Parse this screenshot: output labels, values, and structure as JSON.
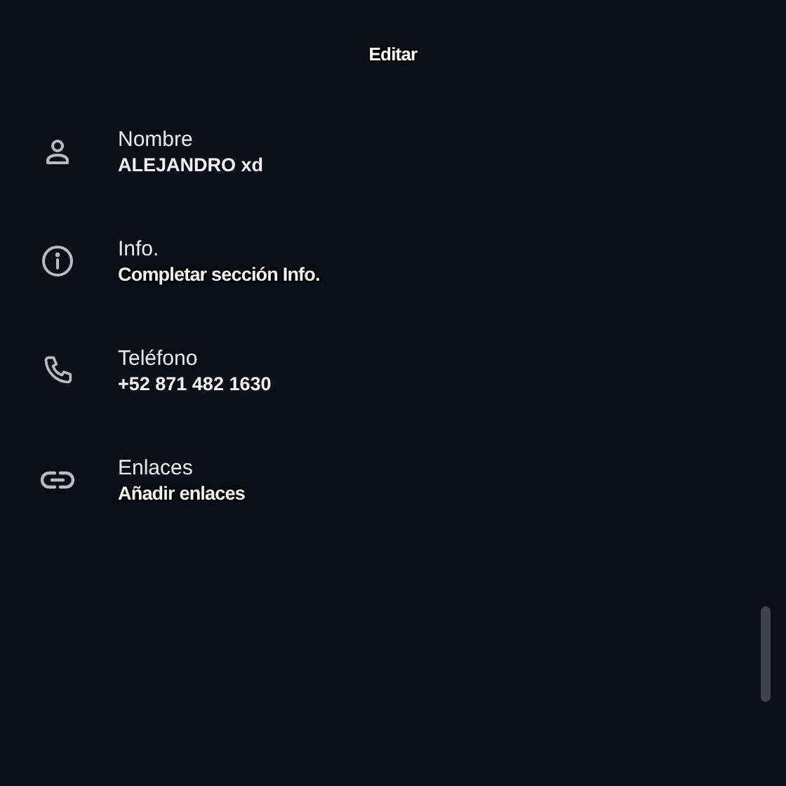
{
  "header": {
    "title": "Editar"
  },
  "fields": [
    {
      "kind": "name",
      "label": "Nombre",
      "value": "ALEJANDRO xd",
      "outlined": false
    },
    {
      "kind": "info",
      "label": "Info.",
      "value": "Completar sección Info.",
      "outlined": true
    },
    {
      "kind": "phone",
      "label": "Teléfono",
      "value": "+52 871 482 1630",
      "outlined": false
    },
    {
      "kind": "links",
      "label": "Enlaces",
      "value": "Añadir enlaces",
      "outlined": true
    }
  ]
}
